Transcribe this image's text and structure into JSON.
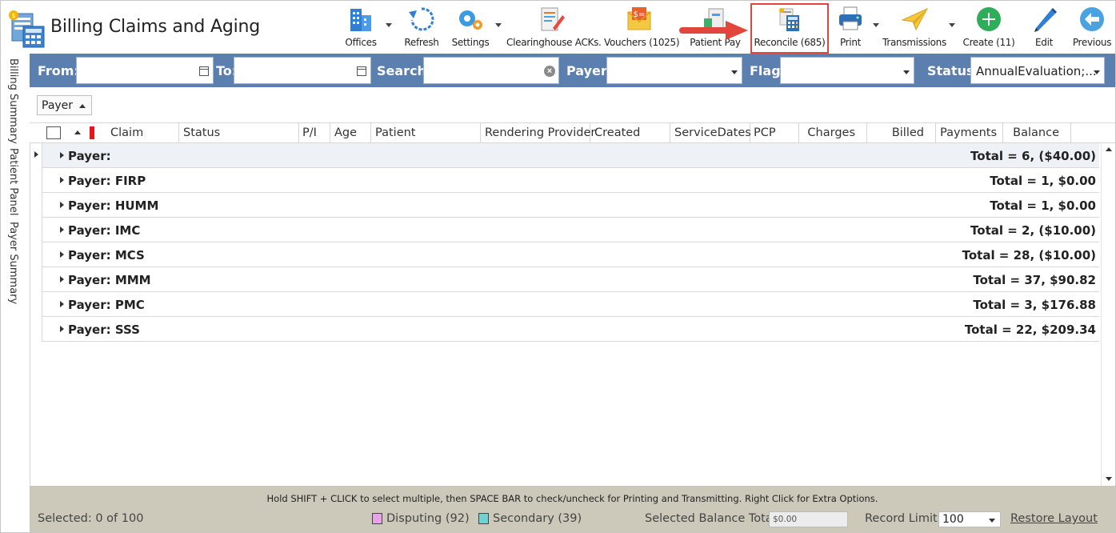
{
  "app": {
    "title": "Billing Claims and Aging"
  },
  "toolbar": {
    "offices": "Offices",
    "refresh": "Refresh",
    "settings": "Settings",
    "clearinghouse": "Clearinghouse ACKs.",
    "vouchers": "Vouchers (1025)",
    "patient_pay": "Patient Pay",
    "reconcile": "Reconcile (685)",
    "print": "Print",
    "transmissions": "Transmissions",
    "create": "Create (11)",
    "edit": "Edit",
    "previous": "Previous"
  },
  "side_tabs": [
    "Billing Summary",
    "Patient Panel",
    "Payer Summary"
  ],
  "filters": {
    "from_label": "From:",
    "to_label": "To:",
    "search_label": "Search:",
    "payer_label": "Payer:",
    "flag_label": "Flag:",
    "status_label": "Status:",
    "status_value": "AnnualEvaluation;...",
    "from_value": "",
    "to_value": "",
    "search_value": "",
    "payer_value": "",
    "flag_value": ""
  },
  "group_by": "Payer",
  "columns": [
    "Claim",
    "Status",
    "P/I",
    "Age",
    "Patient",
    "Rendering Provider",
    "Created",
    "ServiceDates",
    "PCP",
    "Charges",
    "Billed",
    "Payments",
    "Balance"
  ],
  "groups": [
    {
      "label": "Payer:",
      "total": "Total = 6,  ($40.00)"
    },
    {
      "label": "Payer: FIRP",
      "total": "Total = 1,  $0.00"
    },
    {
      "label": "Payer: HUMM",
      "total": "Total = 1,  $0.00"
    },
    {
      "label": "Payer: IMC",
      "total": "Total = 2,  ($10.00)"
    },
    {
      "label": "Payer: MCS",
      "total": "Total = 28,  ($10.00)"
    },
    {
      "label": "Payer: MMM",
      "total": "Total = 37,  $90.82"
    },
    {
      "label": "Payer: PMC",
      "total": "Total = 3,  $176.88"
    },
    {
      "label": "Payer: SSS",
      "total": "Total = 22,  $209.34"
    }
  ],
  "footer": {
    "hint": "Hold SHIFT + CLICK to select multiple, then SPACE BAR to check/uncheck for Printing and Transmitting. Right Click for Extra Options.",
    "selected": "Selected: 0 of 100",
    "disputing": "Disputing (92)",
    "secondary": "Secondary (39)",
    "selected_balance_label": "Selected Balance Total:",
    "selected_balance_value": "$0.00",
    "record_limit_label": "Record Limit:",
    "record_limit_value": "100",
    "restore_layout": "Restore Layout"
  },
  "colors": {
    "filter_bar": "#5b7fae",
    "highlight": "#e2453a",
    "disputing": "#e8a2e8",
    "secondary": "#6fd1d1",
    "footer": "#ccc9bb"
  }
}
